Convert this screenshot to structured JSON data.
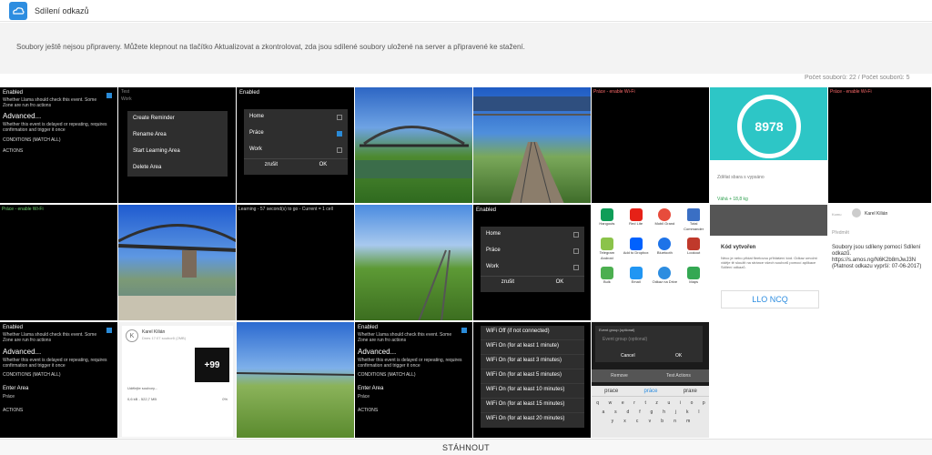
{
  "header": {
    "title": "Sdílení odkazů"
  },
  "notice": "Soubory ještě nejsou připraveny. Můžete klepnout na tlačítko Aktualizovat a zkontrolovat, zda jsou sdílené soubory uložené na server a připravené ke stažení.",
  "count": "Počet souborů: 22 / Počet souborů: 5",
  "footer": {
    "download_label": "STÁHNOUT"
  },
  "tiles": {
    "t1": {
      "enabled": "Enabled",
      "desc": "Whether Llama should check this event. Some Zone are run fro actions",
      "advanced": "Advanced...",
      "adv_desc": "Whether this event is delayed or repeating, requires confirmation and trigger it once",
      "conditions": "CONDITIONS (MATCH ALL)",
      "actions": "ACTIONS"
    },
    "t2": {
      "top1": "Test",
      "top2": "Work",
      "items": [
        "Create Reminder",
        "Rename Area",
        "Start Learning Area",
        "Delete Area"
      ]
    },
    "t3": {
      "enabled": "Enabled",
      "items": [
        "Home",
        "Práce",
        "Work"
      ],
      "btn_cancel": "zrušit",
      "btn_ok": "OK"
    },
    "t6": {
      "label": "Práce - enable Wi-Fi"
    },
    "t7": {
      "number": "8978",
      "line1": "Zdělat sbara s vypsáno",
      "line2": "Váhá + 18,8 kg"
    },
    "t8": {
      "label": "Práce - enable Wi-Fi"
    },
    "t9": {
      "label": "Práce - enable Wi-Fi"
    },
    "t11": {
      "label": "Learning - 57 second(s) to go - Current = 1 cell"
    },
    "t13": {
      "enabled": "Enabled",
      "items": [
        "Home",
        "Práce",
        "Work"
      ],
      "btn_cancel": "zrušit",
      "btn_ok": "OK"
    },
    "t14": {
      "apps": [
        "Hangouts",
        "Red Lite",
        "Mobil Grand",
        "Total Commander",
        "Telegram Android",
        "Add to Dropbox",
        "Bluetooth",
        "Lookout",
        "Bulk",
        "Email",
        "Odkaz na Drive",
        "Maps"
      ]
    },
    "t15": {
      "heading": "Kód vytvořen",
      "text": "Něco je nebo přidat fleetovou přihlášení kód. Odkaz umožní viděje tě sloužit na stránce všech souborů pomocí aplikace Sdílení odkazů.",
      "code": "LLO NCQ"
    },
    "t16": {
      "label_to": "Komu",
      "recipient": "Karel Kilián",
      "label_subject": "Předmět",
      "body": "Soubory jsou sdíleny pomocí Sdílení odkazů. https://s.amos.ng/N6K2b8mJwJ3N (Platnost odkazu vyprší: 07-06-2017)"
    },
    "t17": {
      "enabled": "Enabled",
      "desc": "Whether Llama should check this event. Some Zone are run fro actions",
      "advanced": "Advanced...",
      "adv_desc": "Whether this event is delayed or repeating, requires confirmation and trigger it once",
      "conditions": "CONDITIONS (MATCH ALL)",
      "enter_area": "Enter Area",
      "area": "Práce",
      "actions": "ACTIONS"
    },
    "t18": {
      "avatar": "K",
      "name": "Karel Kilián",
      "sub": "Dnes 17:07 souborů (2MB)",
      "badge": "+99",
      "status": "Udělejte soubory...",
      "size": "0,6 kB - 522,7 MB",
      "percent": "0%"
    },
    "t20": {
      "enabled": "Enabled",
      "desc": "Whether Llama should check this event. Some Zone are run fro actions",
      "advanced": "Advanced...",
      "adv_desc": "Whether this event is delayed or repeating, requires confirmation and trigger it once",
      "conditions": "CONDITIONS (MATCH ALL)",
      "enter_area": "Enter Area",
      "area": "Práce",
      "actions": "ACTIONS"
    },
    "t21": {
      "items": [
        "WiFi Off (if not connected)",
        "WiFi On (for at least 1 minute)",
        "WiFi On (for at least 3 minutes)",
        "WiFi On (for at least 5 minutes)",
        "WiFi On (for at least 10 minutes)",
        "WiFi On (for at least 15 minutes)",
        "WiFi On (for at least 20 minutes)"
      ]
    },
    "t22": {
      "title": "Event group (optional)",
      "placeholder": "Event group (optional)",
      "cancel": "Cancel",
      "ok": "OK",
      "remove": "Remove",
      "test": "Test Actions",
      "suggestions": [
        "prace",
        "práce",
        "praxe"
      ],
      "keys1": [
        "q",
        "w",
        "e",
        "r",
        "t",
        "z",
        "u",
        "i",
        "o",
        "p"
      ],
      "keys2": [
        "a",
        "s",
        "d",
        "f",
        "g",
        "h",
        "j",
        "k",
        "l"
      ],
      "keys3": [
        "y",
        "x",
        "c",
        "v",
        "b",
        "n",
        "m"
      ]
    }
  }
}
